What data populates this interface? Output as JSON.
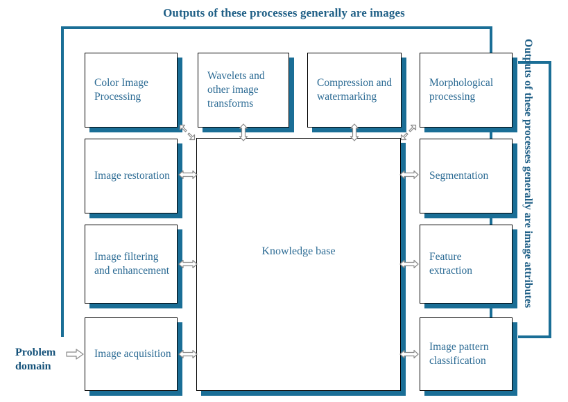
{
  "diagram": {
    "top_caption": "Outputs of these processes generally are images",
    "right_caption": "Outputs of these processes generally are image attributes",
    "problem_domain_label": "Problem\ndomain",
    "problem_domain_line1": "Problem",
    "problem_domain_line2": "domain",
    "accent_color": "#1a6e96",
    "caption_color": "#1f5f86",
    "box_text_color": "#2c6b94",
    "box_border_color": "#000000",
    "background": "#ffffff",
    "center": {
      "label": "Knowledge base"
    },
    "top_row": [
      {
        "id": "color-image-processing",
        "label": "Color Image Processing"
      },
      {
        "id": "wavelets-transforms",
        "label": "Wavelets and other image transforms"
      },
      {
        "id": "compression-watermarking",
        "label": "Compression and watermarking"
      },
      {
        "id": "morphological-processing",
        "label": "Morphological processing"
      }
    ],
    "left_column": [
      {
        "id": "image-restoration",
        "label": "Image restoration"
      },
      {
        "id": "image-filtering-enhancement",
        "label": "Image filtering and enhancement"
      },
      {
        "id": "image-acquisition",
        "label": "Image acquisition"
      }
    ],
    "right_column": [
      {
        "id": "segmentation",
        "label": "Segmentation"
      },
      {
        "id": "feature-extraction",
        "label": "Feature extraction"
      },
      {
        "id": "image-pattern-classification",
        "label": "Image pattern classification"
      }
    ],
    "arrows": [
      {
        "id": "kb-to-color-image",
        "icon": "diagonal-double-arrow-up-left-icon"
      },
      {
        "id": "kb-to-wavelets",
        "icon": "vertical-double-arrow-icon"
      },
      {
        "id": "kb-to-compression",
        "icon": "vertical-double-arrow-icon"
      },
      {
        "id": "kb-to-morphological",
        "icon": "diagonal-double-arrow-up-right-icon"
      },
      {
        "id": "kb-to-restoration",
        "icon": "horizontal-double-arrow-icon"
      },
      {
        "id": "kb-to-filtering",
        "icon": "horizontal-double-arrow-icon"
      },
      {
        "id": "kb-to-acquisition",
        "icon": "horizontal-double-arrow-icon"
      },
      {
        "id": "kb-to-segmentation",
        "icon": "horizontal-double-arrow-icon"
      },
      {
        "id": "kb-to-feature",
        "icon": "horizontal-double-arrow-icon"
      },
      {
        "id": "kb-to-pattern",
        "icon": "horizontal-double-arrow-icon"
      },
      {
        "id": "problem-domain-to-acquisition",
        "icon": "arrow-right-icon"
      }
    ]
  }
}
